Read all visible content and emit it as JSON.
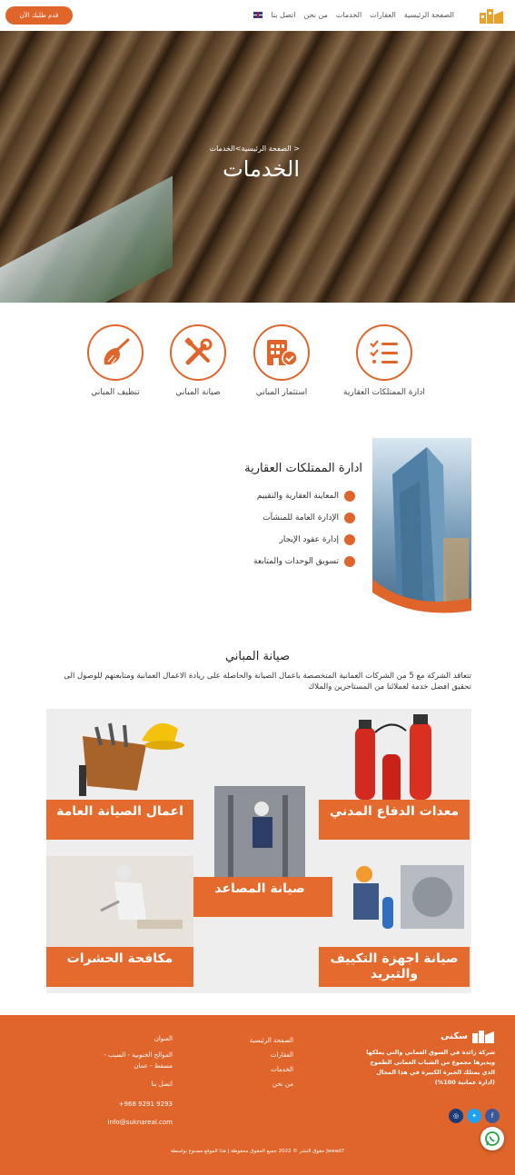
{
  "header": {
    "cta_label": "قدم طلبك الآن",
    "nav": [
      "الصفحة الرئيسية",
      "العقارات",
      "الخدمات",
      "من نحن",
      "اتصل بنا"
    ],
    "language_icon": "uk-flag-icon"
  },
  "hero": {
    "breadcrumb": "الصفحة الرئيسية>الخدمات >",
    "title": "الخدمات"
  },
  "services": [
    {
      "label": "ادارة الممتلكات العقارية",
      "icon": "checklist-icon"
    },
    {
      "label": "استثمار المباني",
      "icon": "building-check-icon"
    },
    {
      "label": "صيانة المباني",
      "icon": "tools-icon"
    },
    {
      "label": "تنظيف المباني",
      "icon": "broom-icon"
    }
  ],
  "property_management": {
    "title": "ادارة الممتلكات العقارية",
    "items": [
      "المعاينة العقارية والتقييم",
      "الإدارة العامة للمنشآت",
      "إدارة عقود الإيجار",
      "تسويق الوحدات والمتابعة"
    ]
  },
  "building_maintenance": {
    "title": "صيانة المباني",
    "description": "تتعاقد الشركة مع 5 من الشركات العمانية المتخصصة باعمال الصيانة والحاصلة على ريادة الاعمال العمانية ومتابعتهم للوصول الى تحقيق افضل خدمة لعملائنا من المستاجرين والملاك",
    "tiles": [
      "معدات الدفاع المدني",
      "اعمال الصيانة العامة",
      "صيانة المصاعد",
      "صيانة اجهزة التكييف والتبريد",
      "مكافحة الحشرات"
    ]
  },
  "footer": {
    "brand": "سكنى",
    "about": "شركة رائدة في السوق العماني والتي يملكها ويديرها مجموع من الشباب العماني الطموح الذي يمتلك الخبرة الكبيرة في هذا المجال (ادارة عمانية 100%)",
    "links": [
      "الصفحة الرئيسية",
      "العقارات",
      "الخدمات",
      "من نحن"
    ],
    "address_heading": "العنوان",
    "address": "الموالح الجنوبية - السيب - مسقط - عمان",
    "contact_heading": "اتصل بنا",
    "phone": "+968 9291 9293",
    "email": "info@suknareal.com",
    "copyright": "حقوق النشر © 2022 جميع الحقوق محفوظة | هذا الموقع مصنوع بواسطة Jawad7"
  },
  "colors": {
    "accent": "#e0652a",
    "text": "#333333"
  }
}
